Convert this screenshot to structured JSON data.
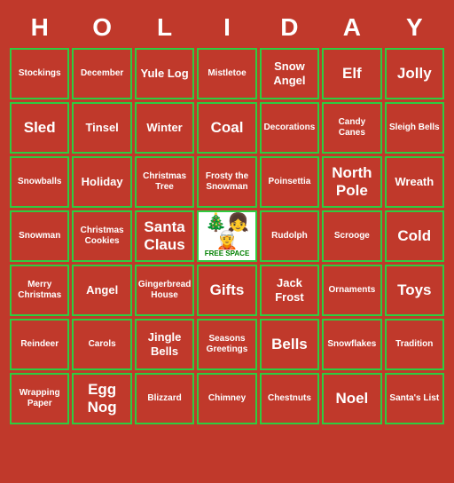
{
  "header": {
    "letters": [
      "H",
      "O",
      "L",
      "I",
      "D",
      "A",
      "Y"
    ]
  },
  "cells": [
    {
      "text": "Stockings",
      "size": "normal"
    },
    {
      "text": "December",
      "size": "normal"
    },
    {
      "text": "Yule Log",
      "size": "large"
    },
    {
      "text": "Mistletoe",
      "size": "normal"
    },
    {
      "text": "Snow Angel",
      "size": "large"
    },
    {
      "text": "Elf",
      "size": "xl"
    },
    {
      "text": "Jolly",
      "size": "xl"
    },
    {
      "text": "Sled",
      "size": "xl"
    },
    {
      "text": "Tinsel",
      "size": "large"
    },
    {
      "text": "Winter",
      "size": "large"
    },
    {
      "text": "Coal",
      "size": "xl"
    },
    {
      "text": "Decorations",
      "size": "normal"
    },
    {
      "text": "Candy Canes",
      "size": "normal"
    },
    {
      "text": "Sleigh Bells",
      "size": "normal"
    },
    {
      "text": "Snowballs",
      "size": "normal"
    },
    {
      "text": "Holiday",
      "size": "large"
    },
    {
      "text": "Christmas Tree",
      "size": "normal"
    },
    {
      "text": "Frosty the Snowman",
      "size": "normal"
    },
    {
      "text": "Poinsettia",
      "size": "normal"
    },
    {
      "text": "North Pole",
      "size": "xl"
    },
    {
      "text": "Wreath",
      "size": "large"
    },
    {
      "text": "Snowman",
      "size": "normal"
    },
    {
      "text": "Christmas Cookies",
      "size": "normal"
    },
    {
      "text": "Santa Claus",
      "size": "xl"
    },
    {
      "text": "FREE",
      "size": "free"
    },
    {
      "text": "Rudolph",
      "size": "normal"
    },
    {
      "text": "Scrooge",
      "size": "normal"
    },
    {
      "text": "Cold",
      "size": "xl"
    },
    {
      "text": "Merry Christmas",
      "size": "normal"
    },
    {
      "text": "Angel",
      "size": "large"
    },
    {
      "text": "Gingerbread House",
      "size": "normal"
    },
    {
      "text": "Gifts",
      "size": "xl"
    },
    {
      "text": "Jack Frost",
      "size": "large"
    },
    {
      "text": "Ornaments",
      "size": "normal"
    },
    {
      "text": "Toys",
      "size": "xl"
    },
    {
      "text": "Reindeer",
      "size": "normal"
    },
    {
      "text": "Carols",
      "size": "normal"
    },
    {
      "text": "Jingle Bells",
      "size": "large"
    },
    {
      "text": "Seasons Greetings",
      "size": "normal"
    },
    {
      "text": "Bells",
      "size": "xl"
    },
    {
      "text": "Snowflakes",
      "size": "normal"
    },
    {
      "text": "Tradition",
      "size": "normal"
    },
    {
      "text": "Wrapping Paper",
      "size": "normal"
    },
    {
      "text": "Egg Nog",
      "size": "xl"
    },
    {
      "text": "Blizzard",
      "size": "normal"
    },
    {
      "text": "Chimney",
      "size": "normal"
    },
    {
      "text": "Chestnuts",
      "size": "normal"
    },
    {
      "text": "Noel",
      "size": "xl"
    },
    {
      "text": "Santa's List",
      "size": "normal"
    }
  ]
}
